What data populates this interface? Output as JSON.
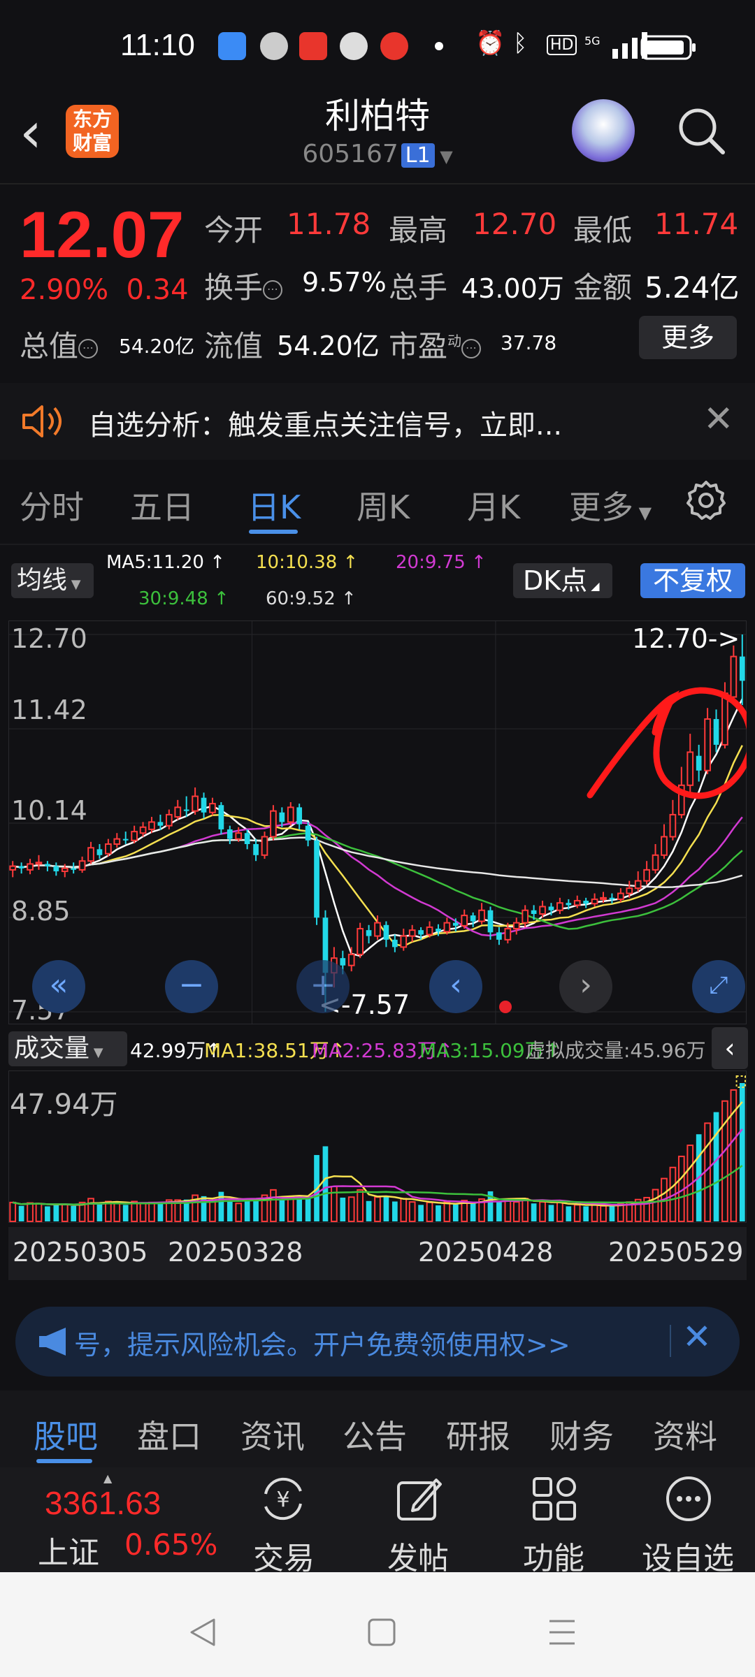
{
  "status_bar": {
    "time": "11:10",
    "right_text": "HD"
  },
  "header": {
    "logo_text": "东方财富",
    "stock_name": "利柏特",
    "stock_code": "605167",
    "level_badge": "L1"
  },
  "quote": {
    "price": "12.07",
    "change_pct": "2.90%",
    "change_abs": "0.34",
    "fields": [
      {
        "label": "今开",
        "value": "11.78"
      },
      {
        "label": "最高",
        "value": "12.70"
      },
      {
        "label": "最低",
        "value": "11.74"
      },
      {
        "label": "换手",
        "value": "9.57%"
      },
      {
        "label": "总手",
        "value": "43.00万"
      },
      {
        "label": "金额",
        "value": "5.24亿"
      },
      {
        "label": "总值",
        "value": "54.20亿"
      },
      {
        "label": "流值",
        "value": "54.20亿"
      },
      {
        "label": "市盈",
        "value": "37.78"
      }
    ],
    "pe_tag": "动",
    "more_label": "更多"
  },
  "alert": {
    "text": "自选分析：触发重点关注信号，立即..."
  },
  "chart_tabs": [
    "分时",
    "五日",
    "日K",
    "周K",
    "月K",
    "更多"
  ],
  "ma_legend": {
    "button": "均线",
    "ma5": "MA5:11.20",
    "ma10": "10:10.38",
    "ma20": "20:9.75",
    "ma30": "30:9.48",
    "ma60": "60:9.52",
    "dk_button": "DK点",
    "adjust_button": "不复权",
    "colors": {
      "ma5": "#ffffff",
      "ma10": "#f5e050",
      "ma20": "#d23ad2",
      "ma30": "#3cc03c",
      "ma60": "#ffffff"
    }
  },
  "chart_data": {
    "type": "candlestick",
    "y_ticks": [
      "12.70",
      "11.42",
      "10.14",
      "8.85",
      "7.57"
    ],
    "ylim": [
      7.57,
      12.7
    ],
    "high_marker": "12.70->",
    "low_marker": "<-7.57",
    "candles": [
      [
        9.5,
        9.55,
        9.4,
        9.62
      ],
      [
        9.55,
        9.52,
        9.45,
        9.6
      ],
      [
        9.5,
        9.58,
        9.44,
        9.65
      ],
      [
        9.58,
        9.6,
        9.5,
        9.7
      ],
      [
        9.58,
        9.55,
        9.48,
        9.62
      ],
      [
        9.55,
        9.48,
        9.42,
        9.6
      ],
      [
        9.48,
        9.52,
        9.4,
        9.58
      ],
      [
        9.52,
        9.5,
        9.45,
        9.6
      ],
      [
        9.5,
        9.62,
        9.46,
        9.68
      ],
      [
        9.62,
        9.8,
        9.58,
        9.88
      ],
      [
        9.78,
        9.7,
        9.65,
        9.85
      ],
      [
        9.72,
        9.85,
        9.68,
        9.92
      ],
      [
        9.85,
        9.92,
        9.8,
        10.0
      ],
      [
        9.92,
        9.9,
        9.85,
        10.02
      ],
      [
        9.9,
        10.02,
        9.86,
        10.1
      ],
      [
        10.0,
        10.08,
        9.95,
        10.15
      ],
      [
        10.05,
        10.15,
        10.0,
        10.22
      ],
      [
        10.15,
        10.1,
        10.04,
        10.25
      ],
      [
        10.1,
        10.25,
        10.05,
        10.32
      ],
      [
        10.22,
        10.35,
        10.18,
        10.45
      ],
      [
        10.32,
        10.3,
        10.22,
        10.5
      ],
      [
        10.3,
        10.5,
        10.25,
        10.62
      ],
      [
        10.48,
        10.28,
        10.2,
        10.55
      ],
      [
        10.28,
        10.4,
        10.24,
        10.48
      ],
      [
        10.38,
        10.05,
        9.98,
        10.42
      ],
      [
        10.05,
        9.92,
        9.85,
        10.1
      ],
      [
        9.92,
        10.0,
        9.88,
        10.08
      ],
      [
        10.0,
        9.85,
        9.78,
        10.05
      ],
      [
        9.85,
        9.7,
        9.62,
        9.92
      ],
      [
        9.7,
        9.95,
        9.65,
        10.02
      ],
      [
        9.95,
        10.3,
        9.9,
        10.38
      ],
      [
        10.28,
        10.15,
        10.08,
        10.35
      ],
      [
        10.15,
        10.35,
        10.1,
        10.42
      ],
      [
        10.35,
        10.12,
        10.05,
        10.4
      ],
      [
        10.1,
        9.9,
        9.82,
        10.15
      ],
      [
        9.9,
        8.85,
        8.75,
        9.95
      ],
      [
        8.85,
        8.1,
        7.57,
        8.95
      ],
      [
        8.1,
        8.3,
        7.9,
        8.45
      ],
      [
        8.3,
        8.2,
        8.08,
        8.4
      ],
      [
        8.2,
        8.35,
        8.12,
        8.45
      ],
      [
        8.35,
        8.7,
        8.3,
        8.78
      ],
      [
        8.68,
        8.6,
        8.5,
        8.75
      ],
      [
        8.6,
        8.78,
        8.55,
        8.88
      ],
      [
        8.75,
        8.55,
        8.45,
        8.8
      ],
      [
        8.55,
        8.45,
        8.38,
        8.62
      ],
      [
        8.45,
        8.6,
        8.4,
        8.7
      ],
      [
        8.6,
        8.68,
        8.52,
        8.75
      ],
      [
        8.68,
        8.62,
        8.55,
        8.72
      ],
      [
        8.62,
        8.72,
        8.58,
        8.8
      ],
      [
        8.7,
        8.66,
        8.6,
        8.76
      ],
      [
        8.66,
        8.78,
        8.62,
        8.85
      ],
      [
        8.78,
        8.74,
        8.66,
        8.84
      ],
      [
        8.74,
        8.88,
        8.7,
        8.96
      ],
      [
        8.88,
        8.8,
        8.72,
        8.92
      ],
      [
        8.8,
        8.95,
        8.76,
        9.05
      ],
      [
        8.95,
        8.65,
        8.55,
        9.0
      ],
      [
        8.65,
        8.55,
        8.48,
        8.72
      ],
      [
        8.55,
        8.7,
        8.5,
        8.78
      ],
      [
        8.7,
        8.78,
        8.62,
        8.85
      ],
      [
        8.78,
        8.95,
        8.72,
        9.02
      ],
      [
        8.95,
        8.9,
        8.82,
        9.02
      ],
      [
        8.9,
        9.0,
        8.85,
        9.08
      ],
      [
        9.0,
        8.95,
        8.88,
        9.05
      ],
      [
        8.95,
        9.05,
        8.9,
        9.12
      ],
      [
        9.05,
        9.02,
        8.96,
        9.1
      ],
      [
        9.02,
        9.08,
        8.98,
        9.15
      ],
      [
        9.08,
        9.04,
        8.98,
        9.12
      ],
      [
        9.04,
        9.1,
        9.0,
        9.18
      ],
      [
        9.1,
        9.12,
        9.05,
        9.2
      ],
      [
        9.12,
        9.1,
        9.04,
        9.18
      ],
      [
        9.1,
        9.18,
        9.06,
        9.25
      ],
      [
        9.18,
        9.25,
        9.12,
        9.35
      ],
      [
        9.25,
        9.35,
        9.2,
        9.48
      ],
      [
        9.35,
        9.5,
        9.3,
        9.62
      ],
      [
        9.5,
        9.7,
        9.45,
        9.85
      ],
      [
        9.7,
        9.95,
        9.65,
        10.12
      ],
      [
        9.95,
        10.25,
        9.9,
        10.45
      ],
      [
        10.25,
        10.65,
        10.2,
        10.9
      ],
      [
        10.65,
        11.1,
        10.55,
        11.35
      ],
      [
        11.05,
        10.85,
        10.7,
        11.2
      ],
      [
        10.85,
        11.55,
        10.8,
        11.7
      ],
      [
        11.55,
        11.2,
        11.1,
        11.68
      ],
      [
        11.2,
        11.9,
        11.15,
        12.05
      ],
      [
        11.85,
        12.4,
        11.8,
        12.55
      ],
      [
        12.4,
        12.07,
        11.74,
        12.7
      ]
    ]
  },
  "volume": {
    "button": "成交量",
    "values_legend": [
      {
        "text": "42.99万",
        "color": "#ffffff"
      },
      {
        "text": "MA1:38.51万",
        "color": "#f5e050"
      },
      {
        "text": "MA2:25.83万",
        "color": "#d23ad2"
      },
      {
        "text": "MA3:15.09万",
        "color": "#3cc03c"
      },
      {
        "text": "虚拟成交量:45.96万",
        "color": "#aaaaaa"
      }
    ],
    "max_label": "47.94万",
    "dates": [
      "20250305",
      "20250328",
      "20250428",
      "20250529"
    ]
  },
  "ad": {
    "text": "号，提示风险机会。开户免费领使用权>>"
  },
  "bottom_tabs": [
    "股吧",
    "盘口",
    "资讯",
    "公告",
    "研报",
    "财务",
    "资料"
  ],
  "footer": {
    "index_value": "3361.63",
    "index_name": "上证",
    "index_pct": "0.65%",
    "buttons": [
      {
        "label": "交易",
        "icon": "yen-refresh-icon"
      },
      {
        "label": "发帖",
        "icon": "edit-icon"
      },
      {
        "label": "功能",
        "icon": "grid-icon"
      },
      {
        "label": "设自选",
        "icon": "more-circle-icon"
      }
    ]
  }
}
